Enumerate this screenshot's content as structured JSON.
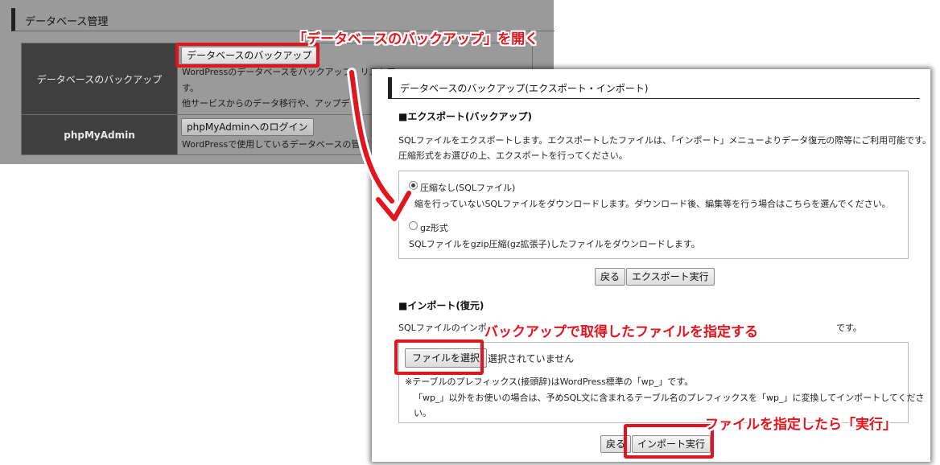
{
  "background": {
    "section_title": "データベース管理",
    "rows": [
      {
        "header": "データベースのバックアップ",
        "button": "データベースのバックアップ",
        "desc1": "WordPressのデータベースをバックアップ・リストア",
        "desc2": "す。",
        "desc3": "他サービスからのデータ移行や、アップデー"
      },
      {
        "header": "phpMyAdmin",
        "button": "phpMyAdminへのログイン",
        "desc1": "WordPressで使用しているデータベースの管理"
      }
    ]
  },
  "dialog": {
    "title": "データベースのバックアップ(エクスポート・インポート)",
    "export": {
      "heading": "■エクスポート(バックアップ)",
      "desc_line1": "SQLファイルをエクスポートします。エクスポートしたファイルは、「インポート」メニューよりデータ復元の際等にご利用可能です。",
      "desc_line2": "圧縮形式をお選びの上、エクスポートを行ってください。",
      "options": [
        {
          "label": "圧縮なし(SQLファイル)",
          "desc": "縮を行っていないSQLファイルをダウンロードします。ダウンロード後、編集等を行う場合はこちらを選んでください。",
          "selected": true
        },
        {
          "label": "gz形式",
          "desc": "SQLファイルをgzip圧縮(gz拡張子)したファイルをダウンロードします。",
          "selected": false
        }
      ],
      "back_label": "戻る",
      "run_label": "エクスポート実行"
    },
    "import": {
      "heading": "■インポート(復元)",
      "desc_start": "SQLファイルのインポ",
      "desc_end": "です。",
      "file_button": "ファイルを選択",
      "file_status": "選択されていません",
      "note_line1": "※テーブルのプレフィックス(接頭辞)はWordPress標準の「wp_」です。",
      "note_line2": "「wp_」以外をお使いの場合は、予めSQL文に含まれるテーブル名のプレフィックスを「wp_」に変換してインポートしてくださ",
      "note_line3": "い。",
      "back_label": "戻る",
      "run_label": "インポート実行"
    }
  },
  "annotations": {
    "open_backup": "「データベースのバックアップ」を開く",
    "select_file": "バックアップで取得したファイルを指定する",
    "execute": "ファイルを指定したら「実行」",
    "color": "#e2141d"
  }
}
